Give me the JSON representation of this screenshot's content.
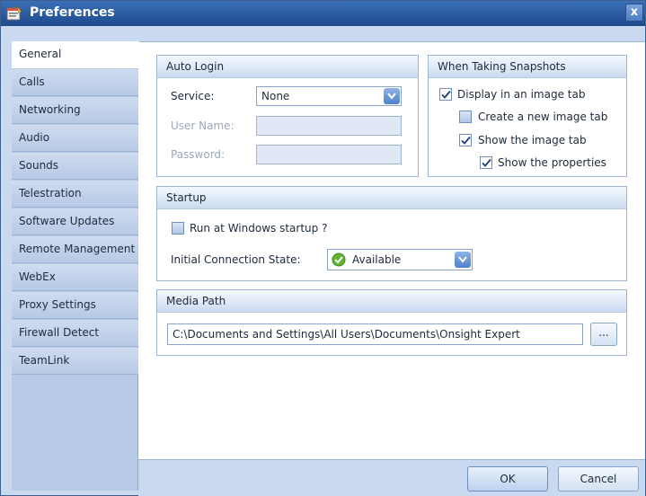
{
  "window": {
    "title": "Preferences",
    "close_label": "x"
  },
  "sidebar": {
    "items": [
      {
        "label": "General",
        "active": true
      },
      {
        "label": "Calls"
      },
      {
        "label": "Networking"
      },
      {
        "label": "Audio"
      },
      {
        "label": "Sounds"
      },
      {
        "label": "Telestration"
      },
      {
        "label": "Software Updates"
      },
      {
        "label": "Remote Management"
      },
      {
        "label": "WebEx"
      },
      {
        "label": "Proxy Settings"
      },
      {
        "label": "Firewall Detect"
      },
      {
        "label": "TeamLink"
      }
    ]
  },
  "auto_login": {
    "header": "Auto Login",
    "service_label": "Service:",
    "service_value": "None",
    "username_label": "User Name:",
    "username_value": "",
    "password_label": "Password:",
    "password_value": ""
  },
  "snapshots": {
    "header": "When Taking Snapshots",
    "display_in_image_tab": {
      "label": "Display in an image tab",
      "checked": true
    },
    "create_new_image_tab": {
      "label": "Create a new image tab",
      "checked": false
    },
    "show_image_tab": {
      "label": "Show the image tab",
      "checked": true
    },
    "show_properties": {
      "label": "Show the properties",
      "checked": true
    }
  },
  "startup": {
    "header": "Startup",
    "run_at_startup": {
      "label": "Run at Windows startup ?",
      "checked": false
    },
    "initial_state_label": "Initial Connection State:",
    "initial_state_value": "Available"
  },
  "media_path": {
    "header": "Media Path",
    "value": "C:\\Documents and Settings\\All Users\\Documents\\Onsight Expert",
    "browse_label": "..."
  },
  "buttons": {
    "ok": "OK",
    "cancel": "Cancel"
  },
  "colors": {
    "title_bar": "#2a5aa0",
    "sidebar": "#b8cbe6",
    "accent": "#4e81cc",
    "status_available": "#5fb52f"
  }
}
